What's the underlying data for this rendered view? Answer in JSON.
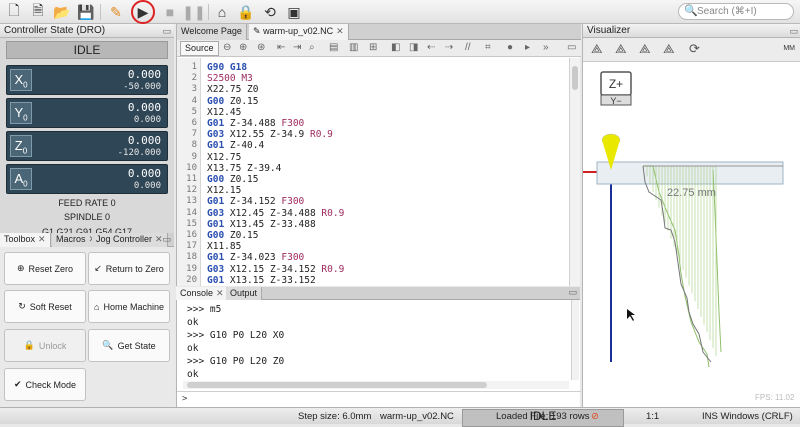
{
  "toolbar": {
    "search_placeholder": "Search (⌘+I)"
  },
  "dro": {
    "title": "Controller State (DRO)",
    "state": "IDLE",
    "axes": [
      {
        "label": "X",
        "sub": "0",
        "work": "0.000",
        "machine": "-50.000"
      },
      {
        "label": "Y",
        "sub": "0",
        "work": "0.000",
        "machine": "0.000"
      },
      {
        "label": "Z",
        "sub": "0",
        "work": "0.000",
        "machine": "-120.000"
      },
      {
        "label": "A",
        "sub": "0",
        "work": "0.000",
        "machine": "0.000"
      }
    ],
    "feed_rate_label": "FEED RATE",
    "feed_rate_value": "0",
    "spindle_label": "SPINDLE",
    "spindle_value": "0",
    "gcode_state": "G1 G21 G91 G54 G17"
  },
  "left_tabs": {
    "toolbox": "Toolbox",
    "macros": "Macros",
    "jog": "Jog Controller"
  },
  "toolbox": {
    "reset_zero": "Reset Zero",
    "return_to_zero": "Return to Zero",
    "soft_reset": "Soft Reset",
    "home_machine": "Home Machine",
    "unlock": "Unlock",
    "get_state": "Get State",
    "check_mode": "Check Mode"
  },
  "editor": {
    "tab_welcome": "Welcome Page",
    "tab_file": "warm-up_v02.NC",
    "source_button": "Source",
    "lines": [
      "G90 G18",
      "S2500 M3",
      "X22.75 Z0",
      "G00 Z0.15",
      "X12.45",
      "G01 Z-34.488 F300",
      "G03 X12.55 Z-34.9 R0.9",
      "G01 Z-40.4",
      "X12.75",
      "X13.75 Z-39.4",
      "G00 Z0.15",
      "X12.15",
      "G01 Z-34.152 F300",
      "G03 X12.45 Z-34.488 R0.9",
      "G01 X13.45 Z-33.488",
      "G00 Z0.15",
      "X11.85",
      "G01 Z-34.023 F300",
      "G03 X12.15 Z-34.152 R0.9",
      "G01 X13.15 Z-33.152"
    ]
  },
  "console": {
    "tab_console": "Console",
    "tab_output": "Output",
    "lines": [
      ">>> m5",
      "ok",
      ">>> G10 P0 L20 X0",
      "ok",
      ">>> G10 P0 L20 Z0",
      "ok"
    ],
    "prompt": ">"
  },
  "visualizer": {
    "title": "Visualizer",
    "units": "MM",
    "zplus": "Z+",
    "yminus": "Y−",
    "dimension_label": "22.75 mm",
    "fps": "FPS: 11.02"
  },
  "status": {
    "step_size": "Step size: 6.0mm",
    "file": "warm-up_v02.NC",
    "state": "IDLE",
    "loaded": "Loaded File: 193 rows",
    "ratio": "1:1",
    "mode": "INS Windows (CRLF)"
  },
  "colors": {
    "dro_bg": "#2f4656",
    "play_ring": "#dd2222",
    "axis_red": "#d22020",
    "axis_blue": "#1a2e9a",
    "toolpath_green": "#8fbf6a"
  }
}
